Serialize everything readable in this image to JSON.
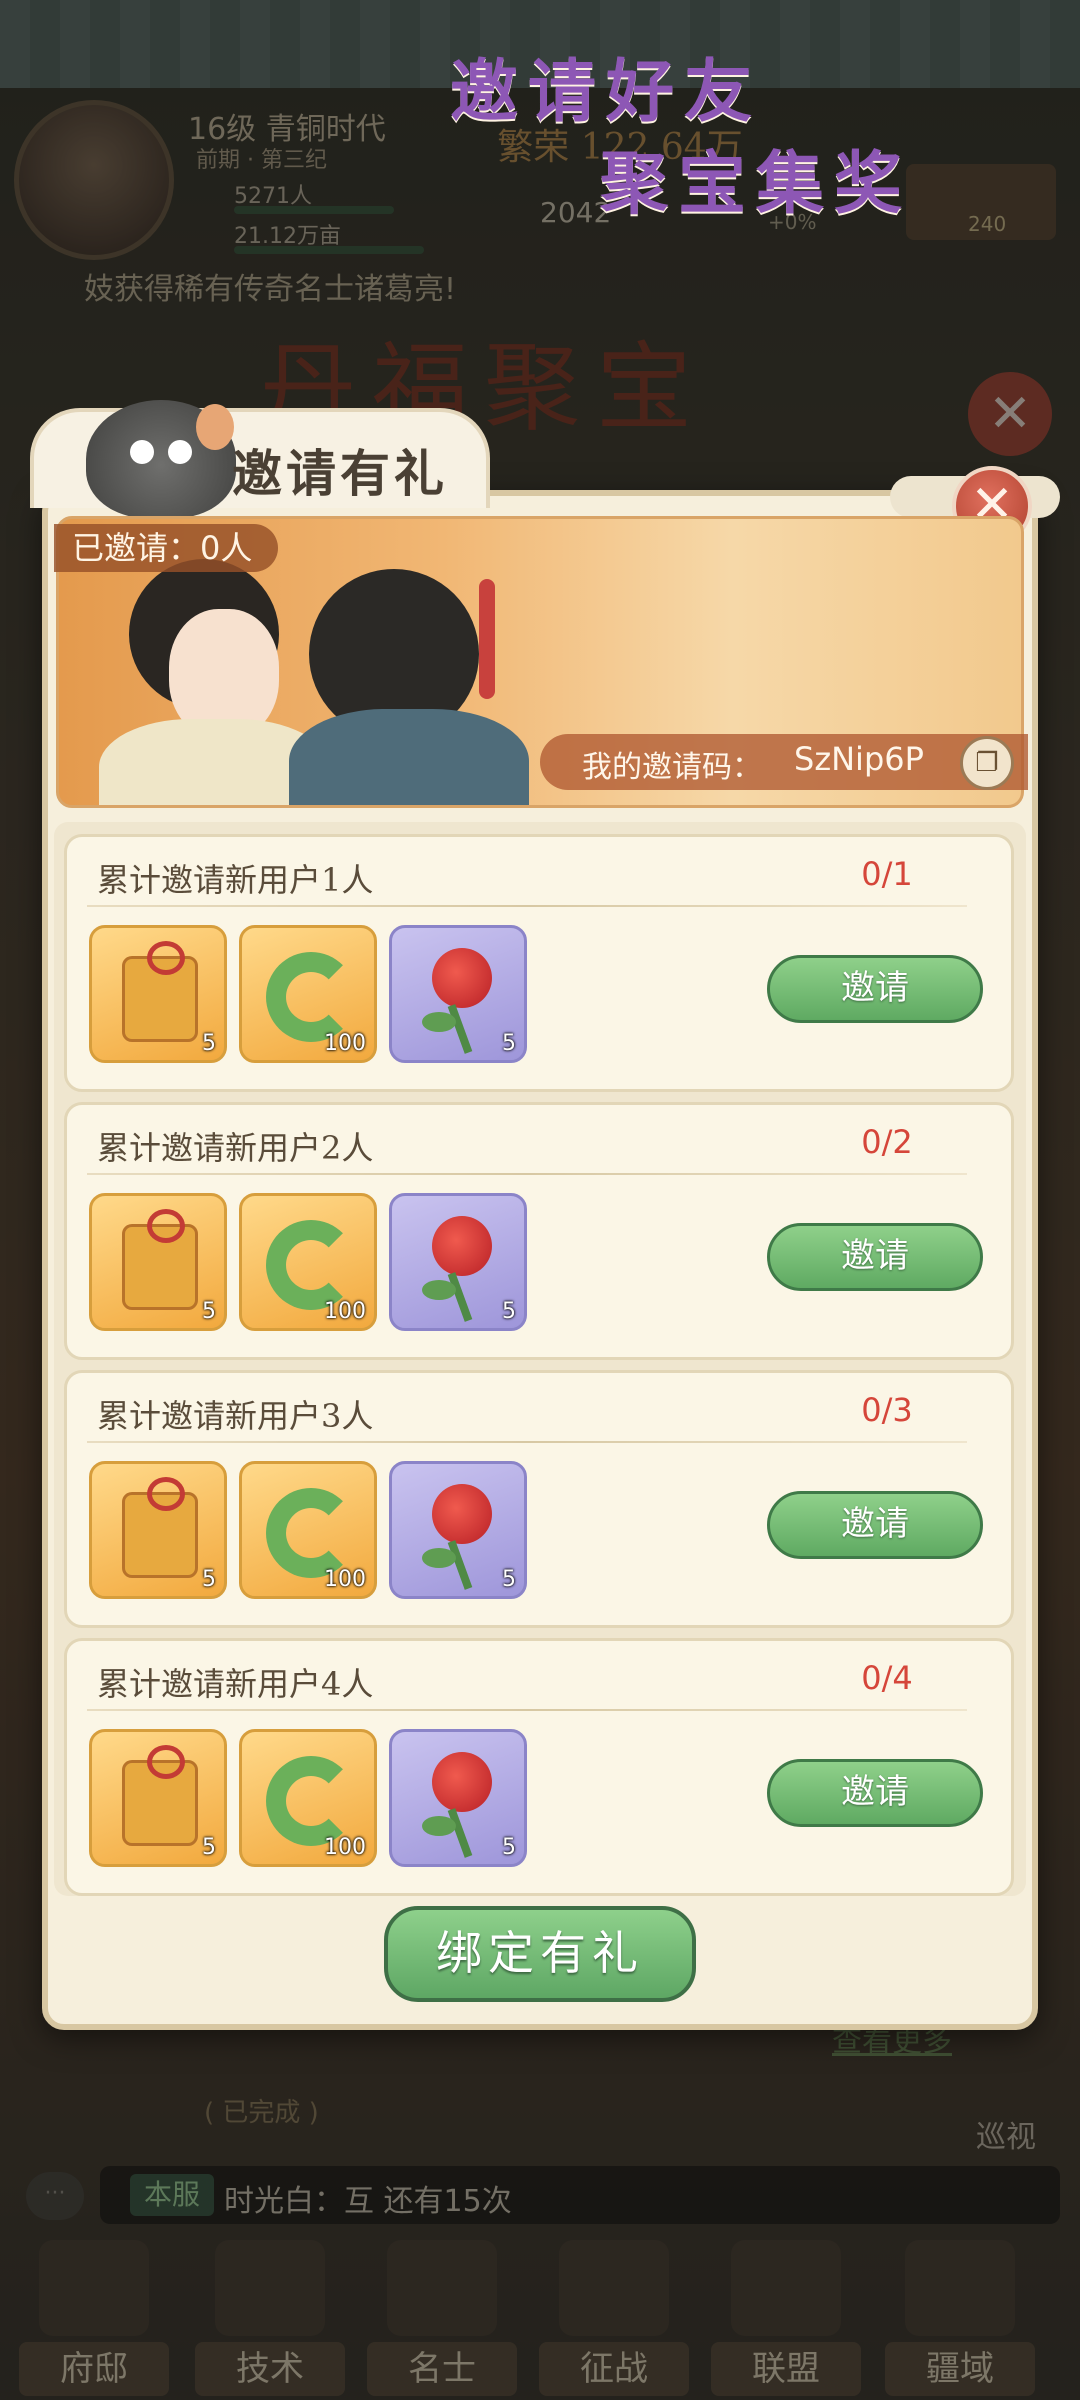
{
  "hud": {
    "level_title": "16级 青铜时代",
    "era": "前期 · 第三纪",
    "population": "5271人",
    "land": "21.12万亩",
    "prosperity": "繁荣 122.64万",
    "jade_count": "2042",
    "bonus_pct": "+0%",
    "gift_count": "240",
    "ticker": "妓获得稀有传奇名士诸葛亮!"
  },
  "background": {
    "banner_text": "丹福聚宝",
    "view_more": "查看更多",
    "completed": "( 已完成 )",
    "patrol": "巡视"
  },
  "chat": {
    "bubble": "···",
    "server_tag": "本服",
    "message": "时光白：互 还有15次"
  },
  "nav": [
    {
      "label": "府邸"
    },
    {
      "label": "技术"
    },
    {
      "label": "名士"
    },
    {
      "label": "征战"
    },
    {
      "label": "联盟"
    },
    {
      "label": "疆域"
    }
  ],
  "modal": {
    "title": "邀请有礼",
    "close_symbol": "✕",
    "invited_label": "已邀请：0人",
    "hero_line1": "邀请好友",
    "hero_line2": "聚宝集奖",
    "code_label": "我的邀请码：",
    "code_value": "SzNip6P",
    "copy_symbol": "❐",
    "tasks": [
      {
        "title": "累计邀请新用户1人",
        "progress": "0/1",
        "rewards": [
          {
            "icon": "gold-pouch-icon",
            "qty": "5"
          },
          {
            "icon": "jade-dragon-icon",
            "qty": "100"
          },
          {
            "icon": "red-rose-icon",
            "qty": "5"
          }
        ],
        "button": "邀请"
      },
      {
        "title": "累计邀请新用户2人",
        "progress": "0/2",
        "rewards": [
          {
            "icon": "gold-pouch-icon",
            "qty": "5"
          },
          {
            "icon": "jade-dragon-icon",
            "qty": "100"
          },
          {
            "icon": "red-rose-icon",
            "qty": "5"
          }
        ],
        "button": "邀请"
      },
      {
        "title": "累计邀请新用户3人",
        "progress": "0/3",
        "rewards": [
          {
            "icon": "gold-pouch-icon",
            "qty": "5"
          },
          {
            "icon": "jade-dragon-icon",
            "qty": "100"
          },
          {
            "icon": "red-rose-icon",
            "qty": "5"
          }
        ],
        "button": "邀请"
      },
      {
        "title": "累计邀请新用户4人",
        "progress": "0/4",
        "rewards": [
          {
            "icon": "gold-pouch-icon",
            "qty": "5"
          },
          {
            "icon": "jade-dragon-icon",
            "qty": "100"
          },
          {
            "icon": "red-rose-icon",
            "qty": "5"
          }
        ],
        "button": "邀请"
      }
    ],
    "bind_button": "绑定有礼"
  }
}
